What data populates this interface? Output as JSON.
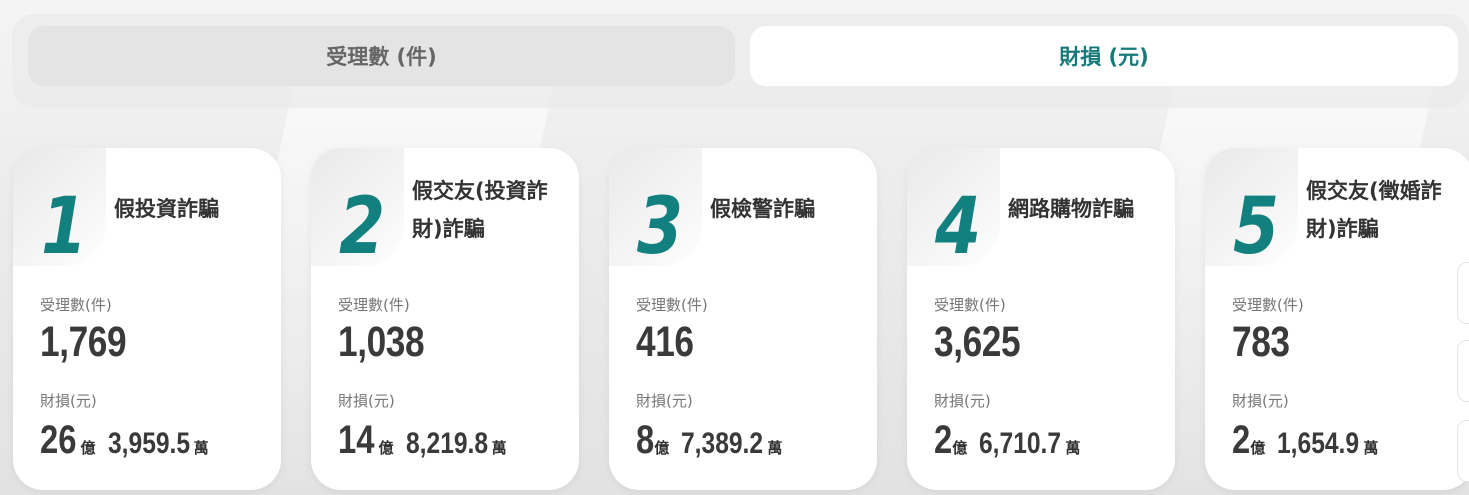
{
  "tabs": [
    {
      "label": "受理數 (件)",
      "active": false
    },
    {
      "label": "財損 (元)",
      "active": true
    }
  ],
  "accent_color": "#12807f",
  "labels": {
    "cases": "受理數(件)",
    "loss": "財損(元)",
    "yi": "億",
    "wan": "萬"
  },
  "cards": [
    {
      "rank": "1",
      "title": "假投資詐騙",
      "cases": "1,769",
      "loss_yi": "26",
      "loss_wan": "3,959.5"
    },
    {
      "rank": "2",
      "title": "假交友(投資詐財)詐騙",
      "cases": "1,038",
      "loss_yi": "14",
      "loss_wan": "8,219.8"
    },
    {
      "rank": "3",
      "title": "假檢警詐騙",
      "cases": "416",
      "loss_yi": "8",
      "loss_wan": "7,389.2"
    },
    {
      "rank": "4",
      "title": "網路購物詐騙",
      "cases": "3,625",
      "loss_yi": "2",
      "loss_wan": "6,710.7"
    },
    {
      "rank": "5",
      "title": "假交友(徵婚詐財)詐騙",
      "cases": "783",
      "loss_yi": "2",
      "loss_wan": "1,654.9"
    }
  ]
}
